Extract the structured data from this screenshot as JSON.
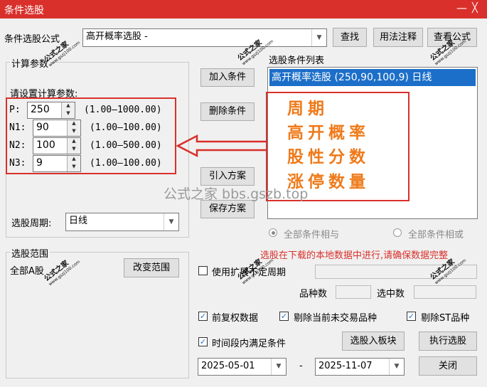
{
  "window": {
    "title": "条件选股",
    "minimize_glyph": "—",
    "close_glyph": "╳"
  },
  "formula_row": {
    "label": "条件选股公式",
    "selected_formula": "高开概率选股  -",
    "find_button": "查找",
    "usage_button": "用法注释",
    "view_button": "查看公式"
  },
  "params": {
    "group_label": "计算参数",
    "prompt": "请设置计算参数:",
    "rows": [
      {
        "name": "P:",
        "value": "250",
        "range": "(1.00—1000.00)"
      },
      {
        "name": "N1:",
        "value": "90",
        "range": "(1.00—100.00)"
      },
      {
        "name": "N2:",
        "value": "100",
        "range": "(1.00—500.00)"
      },
      {
        "name": "N3:",
        "value": "9",
        "range": "(1.00—100.00)"
      }
    ],
    "period_label": "选股周期:",
    "period_value": "日线"
  },
  "middle_buttons": {
    "add": "加入条件",
    "remove": "删除条件",
    "import": "引入方案",
    "save": "保存方案"
  },
  "conditions": {
    "label": "选股条件列表",
    "items": [
      "高开概率选股 (250,90,100,9) 日线"
    ],
    "annotation_lines": [
      "周期",
      "高开概率",
      "股性分数",
      "涨停数量"
    ]
  },
  "watermark_url": "公式之家 bbs.gszb.top",
  "logic": {
    "all_and": "全部条件相与",
    "all_or": "全部条件相或"
  },
  "range": {
    "group_label": "选股范围",
    "value": "全部A股",
    "change_button": "改变范围"
  },
  "notice": "选股在下载的本地数据中进行,请确保数据完整",
  "options": {
    "use_variable_period": "使用扩展不定周期",
    "variety_count_label": "品种数",
    "selected_count_label": "选中数",
    "forward_adjust": "前复权数据",
    "exclude_untraded": "剔除当前未交易品种",
    "exclude_st": "剔除ST品种",
    "time_range": "时间段内满足条件"
  },
  "bottom": {
    "to_sector_button": "选股入板块",
    "execute_button": "执行选股",
    "close_button": "关闭",
    "start_date": "2025-05-01",
    "date_separator": "-",
    "end_date": "2025-11-07"
  },
  "stamp": {
    "text": "公式之家",
    "url": "www.gszj100.com"
  },
  "colors": {
    "titlebar": "#d9302b",
    "selection": "#1c6fc8",
    "annotation_border": "#d9302b",
    "annotation_text": "#ef7a1a",
    "notice": "#d9302b"
  }
}
